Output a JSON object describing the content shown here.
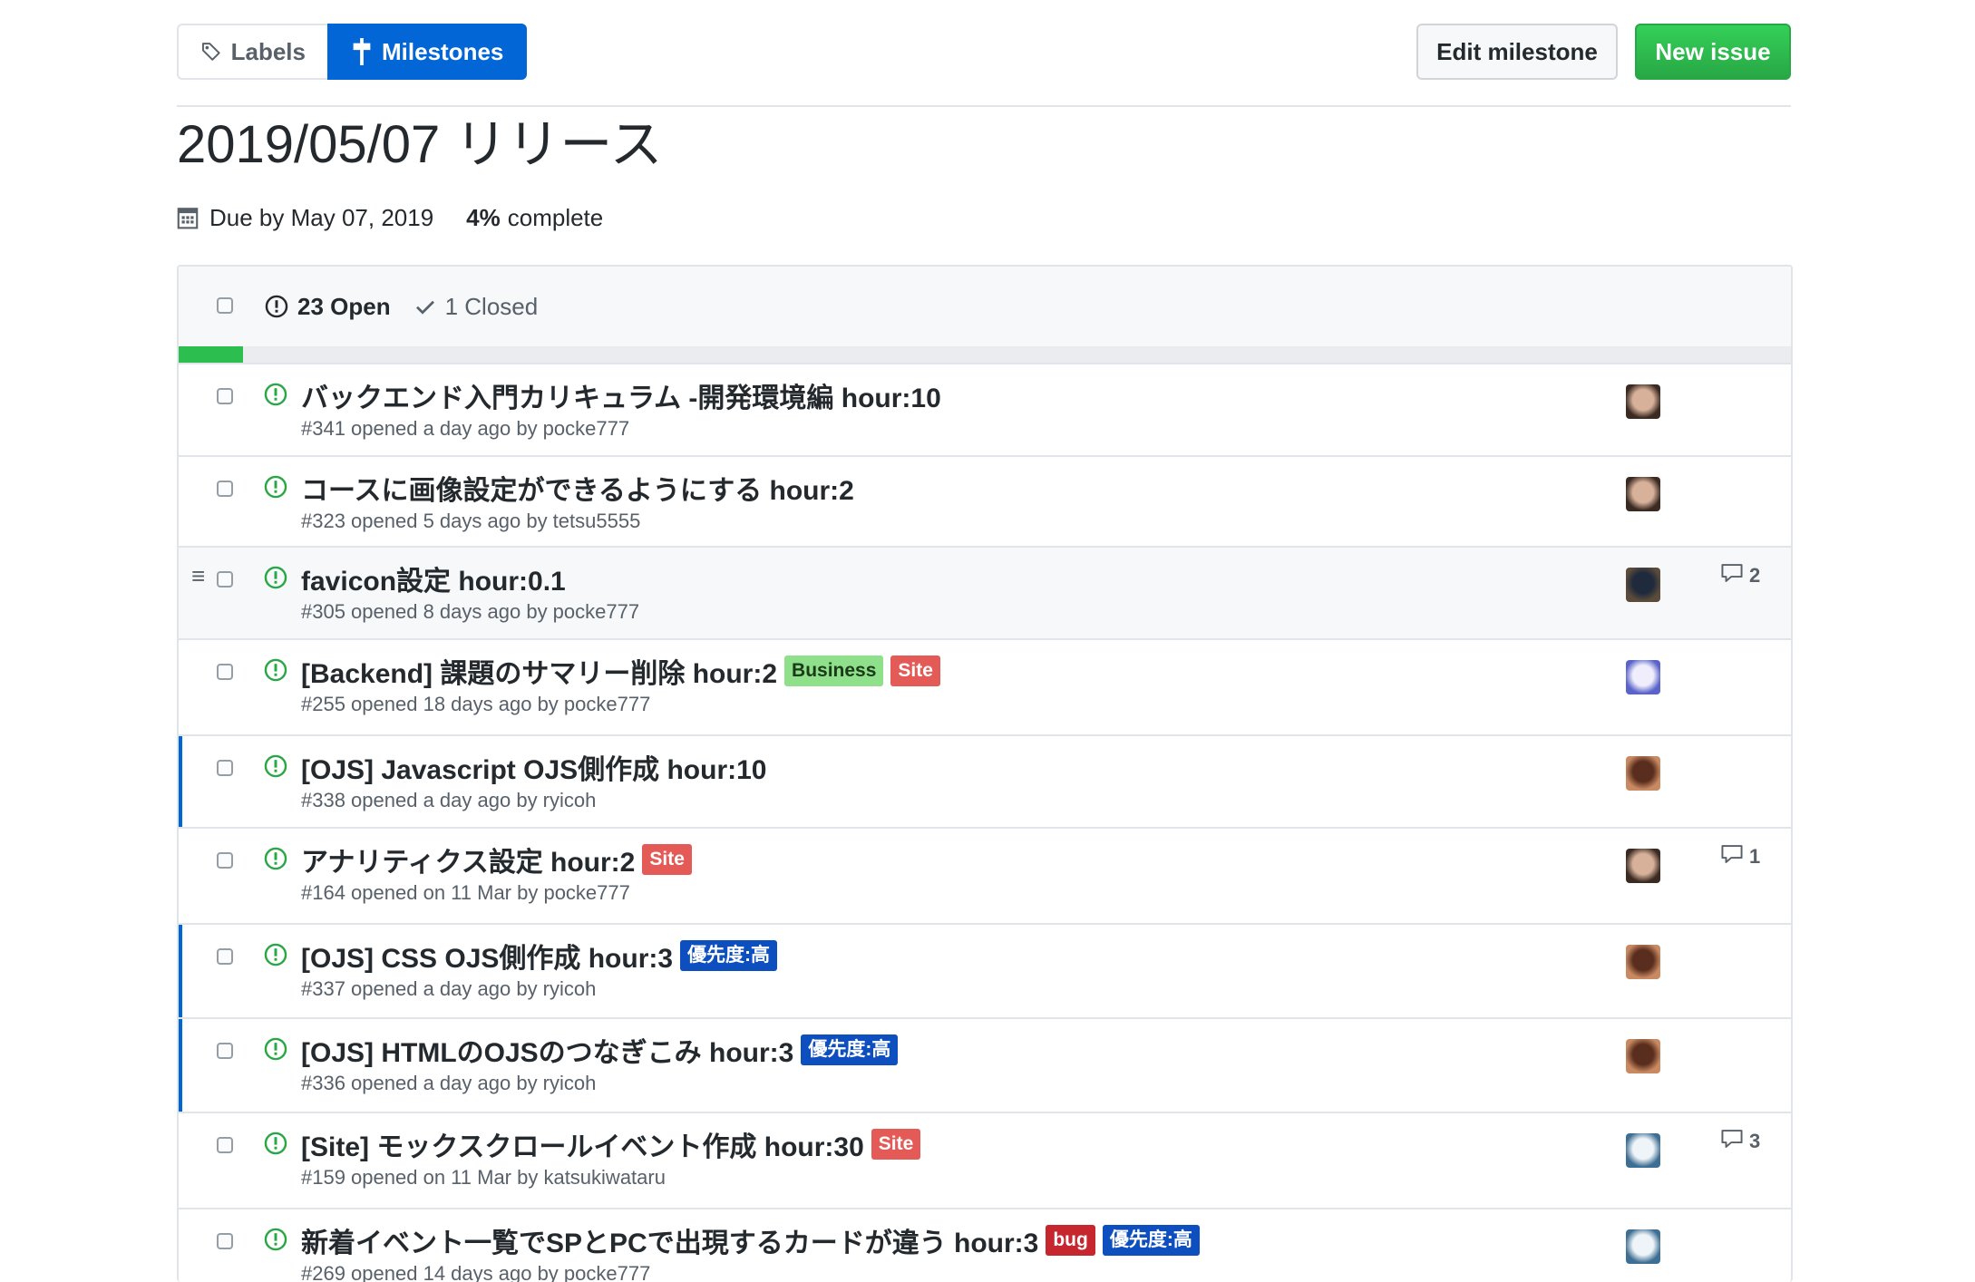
{
  "nav": {
    "labels_label": "Labels",
    "milestones_label": "Milestones"
  },
  "actions": {
    "edit_label": "Edit milestone",
    "new_label": "New issue"
  },
  "milestone": {
    "title": "2019/05/07 リリース",
    "due": "Due by May 07, 2019",
    "percent_text": "4%",
    "complete_text": "complete",
    "progress": 0.04
  },
  "states": {
    "open": "23 Open",
    "closed": "1 Closed"
  },
  "colors": {
    "accent": "#0366d6",
    "green": "#28a745"
  },
  "issues": [
    {
      "title": "バックエンド入門カリキュラム -開発環境編 hour:10",
      "sub": "#341 opened a day ago by pocke777",
      "labels": [],
      "avatar": "face",
      "comments": ""
    },
    {
      "title": "コースに画像設定ができるようにする hour:2",
      "sub": "#323 opened 5 days ago by tetsu5555",
      "labels": [],
      "avatar": "face",
      "comments": ""
    },
    {
      "title": "favicon設定 hour:0.1",
      "sub": "#305 opened 8 days ago by pocke777",
      "labels": [],
      "avatar": "dark",
      "comments": "2"
    },
    {
      "title": "[Backend] 課題のサマリー削除 hour:2",
      "sub": "#255 opened 18 days ago by pocke777",
      "labels": [
        {
          "name": "Business",
          "bg": "#8fe08a",
          "fg": "#1b3a18"
        },
        {
          "name": "Site",
          "bg": "#e45a56",
          "fg": "#ffffff"
        }
      ],
      "avatar": "purple",
      "comments": ""
    },
    {
      "title": "[OJS] Javascript OJS側作成 hour:10",
      "sub": "#338 opened a day ago by ryicoh",
      "labels": [],
      "avatar": "brown",
      "comments": ""
    },
    {
      "title": "アナリティクス設定 hour:2",
      "sub": "#164 opened on 11 Mar by pocke777",
      "labels": [
        {
          "name": "Site",
          "bg": "#e45a56",
          "fg": "#ffffff"
        }
      ],
      "avatar": "face",
      "comments": "1"
    },
    {
      "title": "[OJS] CSS OJS側作成 hour:3",
      "sub": "#337 opened a day ago by ryicoh",
      "labels": [
        {
          "name": "優先度:高",
          "bg": "#0e4fbf",
          "fg": "#ffffff"
        }
      ],
      "avatar": "brown",
      "comments": ""
    },
    {
      "title": "[OJS] HTMLのOJSのつなぎこみ hour:3",
      "sub": "#336 opened a day ago by ryicoh",
      "labels": [
        {
          "name": "優先度:高",
          "bg": "#0e4fbf",
          "fg": "#ffffff"
        }
      ],
      "avatar": "brown",
      "comments": ""
    },
    {
      "title": "[Site] モックスクロールイベント作成 hour:30",
      "sub": "#159 opened on 11 Mar by katsukiwataru",
      "labels": [
        {
          "name": "Site",
          "bg": "#e45a56",
          "fg": "#ffffff"
        }
      ],
      "avatar": "wave",
      "comments": "3"
    },
    {
      "title": "新着イベント一覧でSPとPCで出現するカードが違う hour:3",
      "sub": "#269 opened 14 days ago by pocke777",
      "labels": [
        {
          "name": "bug",
          "bg": "#c6262e",
          "fg": "#ffffff"
        },
        {
          "name": "優先度:高",
          "bg": "#0e4fbf",
          "fg": "#ffffff"
        }
      ],
      "avatar": "wave",
      "comments": ""
    }
  ]
}
